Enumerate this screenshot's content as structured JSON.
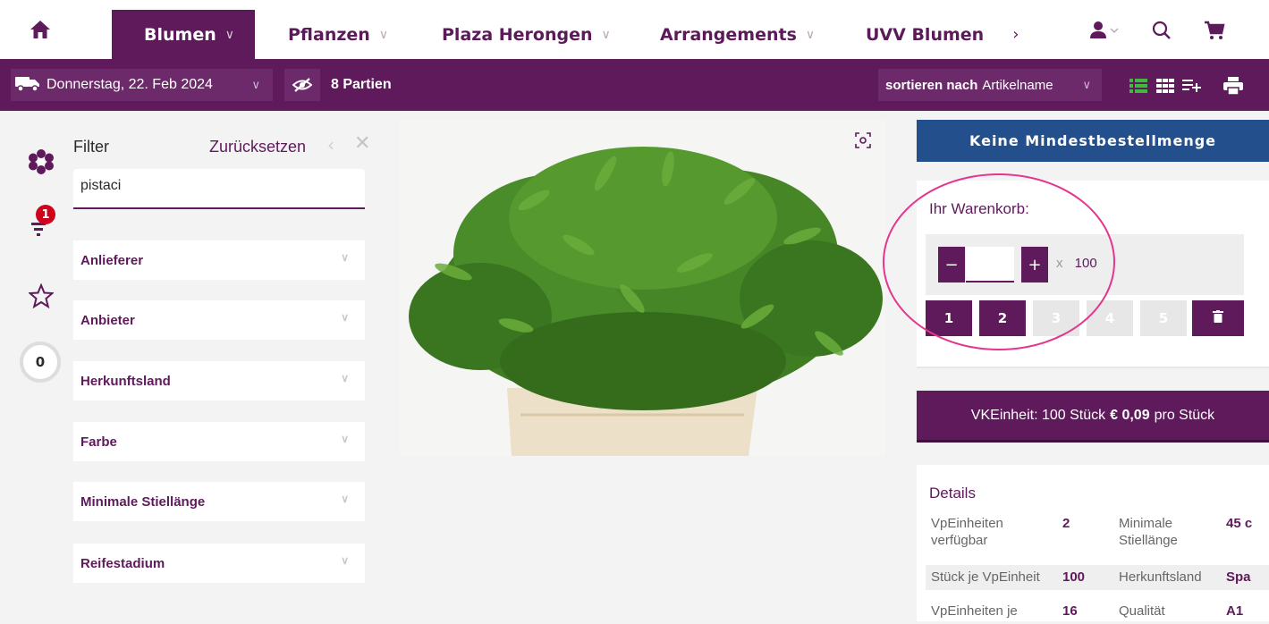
{
  "topnav": {
    "items": [
      {
        "label": "Blumen",
        "active": true
      },
      {
        "label": "Pflanzen",
        "active": false
      },
      {
        "label": "Plaza Herongen",
        "active": false
      },
      {
        "label": "Arrangements",
        "active": false
      },
      {
        "label": "UVV Blumen",
        "active": false
      }
    ],
    "more_glyph": "›",
    "icons": [
      "home-icon",
      "user-icon",
      "search-icon",
      "cart-icon"
    ]
  },
  "toolbar": {
    "date": "Donnerstag, 22. Feb 2024",
    "lots": "8 Partien",
    "sort_prefix": "sortieren nach",
    "sort_value": "Artikelname",
    "view_icons": [
      "list-view-icon",
      "grid-view-icon",
      "add-list-icon",
      "print-icon"
    ]
  },
  "rail": {
    "filter_badge": "1",
    "count": "0"
  },
  "filter": {
    "label": "Filter",
    "reset_label": "Zurücksetzen",
    "search_value": "pistaci",
    "facets": [
      "Anlieferer",
      "Anbieter",
      "Herkunftsland",
      "Farbe",
      "Minimale Stiellänge",
      "Reifestadium"
    ]
  },
  "product": {
    "min_order_banner": "Keine Mindestbestellmenge",
    "cart_title": "Ihr Warenkorb:",
    "minus": "−",
    "plus": "+",
    "quantity_value": "",
    "times_label": "x",
    "multiplier": "100",
    "quantity_buttons": [
      {
        "label": "1",
        "enabled": true
      },
      {
        "label": "2",
        "enabled": true
      },
      {
        "label": "3",
        "enabled": false
      },
      {
        "label": "4",
        "enabled": false
      },
      {
        "label": "5",
        "enabled": false
      }
    ],
    "unit_text": "VKEinheit: 100 Stück",
    "price": "€ 0,09",
    "price_suffix": "pro Stück"
  },
  "details": {
    "title": "Details",
    "rows": [
      {
        "l1": "VpEinheiten verfügbar",
        "v1": "2",
        "l2": "Minimale Stiellänge",
        "v2": "45 c"
      },
      {
        "l1": "Stück je VpEinheit",
        "v1": "100",
        "l2": "Herkunftsland",
        "v2": "Spa"
      },
      {
        "l1": "VpEinheiten je",
        "v1": "16",
        "l2": "Qualität",
        "v2": "A1"
      }
    ]
  },
  "colors": {
    "brand_purple": "#5e1a5b",
    "banner_blue": "#244f8d",
    "badge_red": "#d0021b",
    "highlight_pink": "#e4358f",
    "list_icon_green": "#3dbb3d"
  }
}
